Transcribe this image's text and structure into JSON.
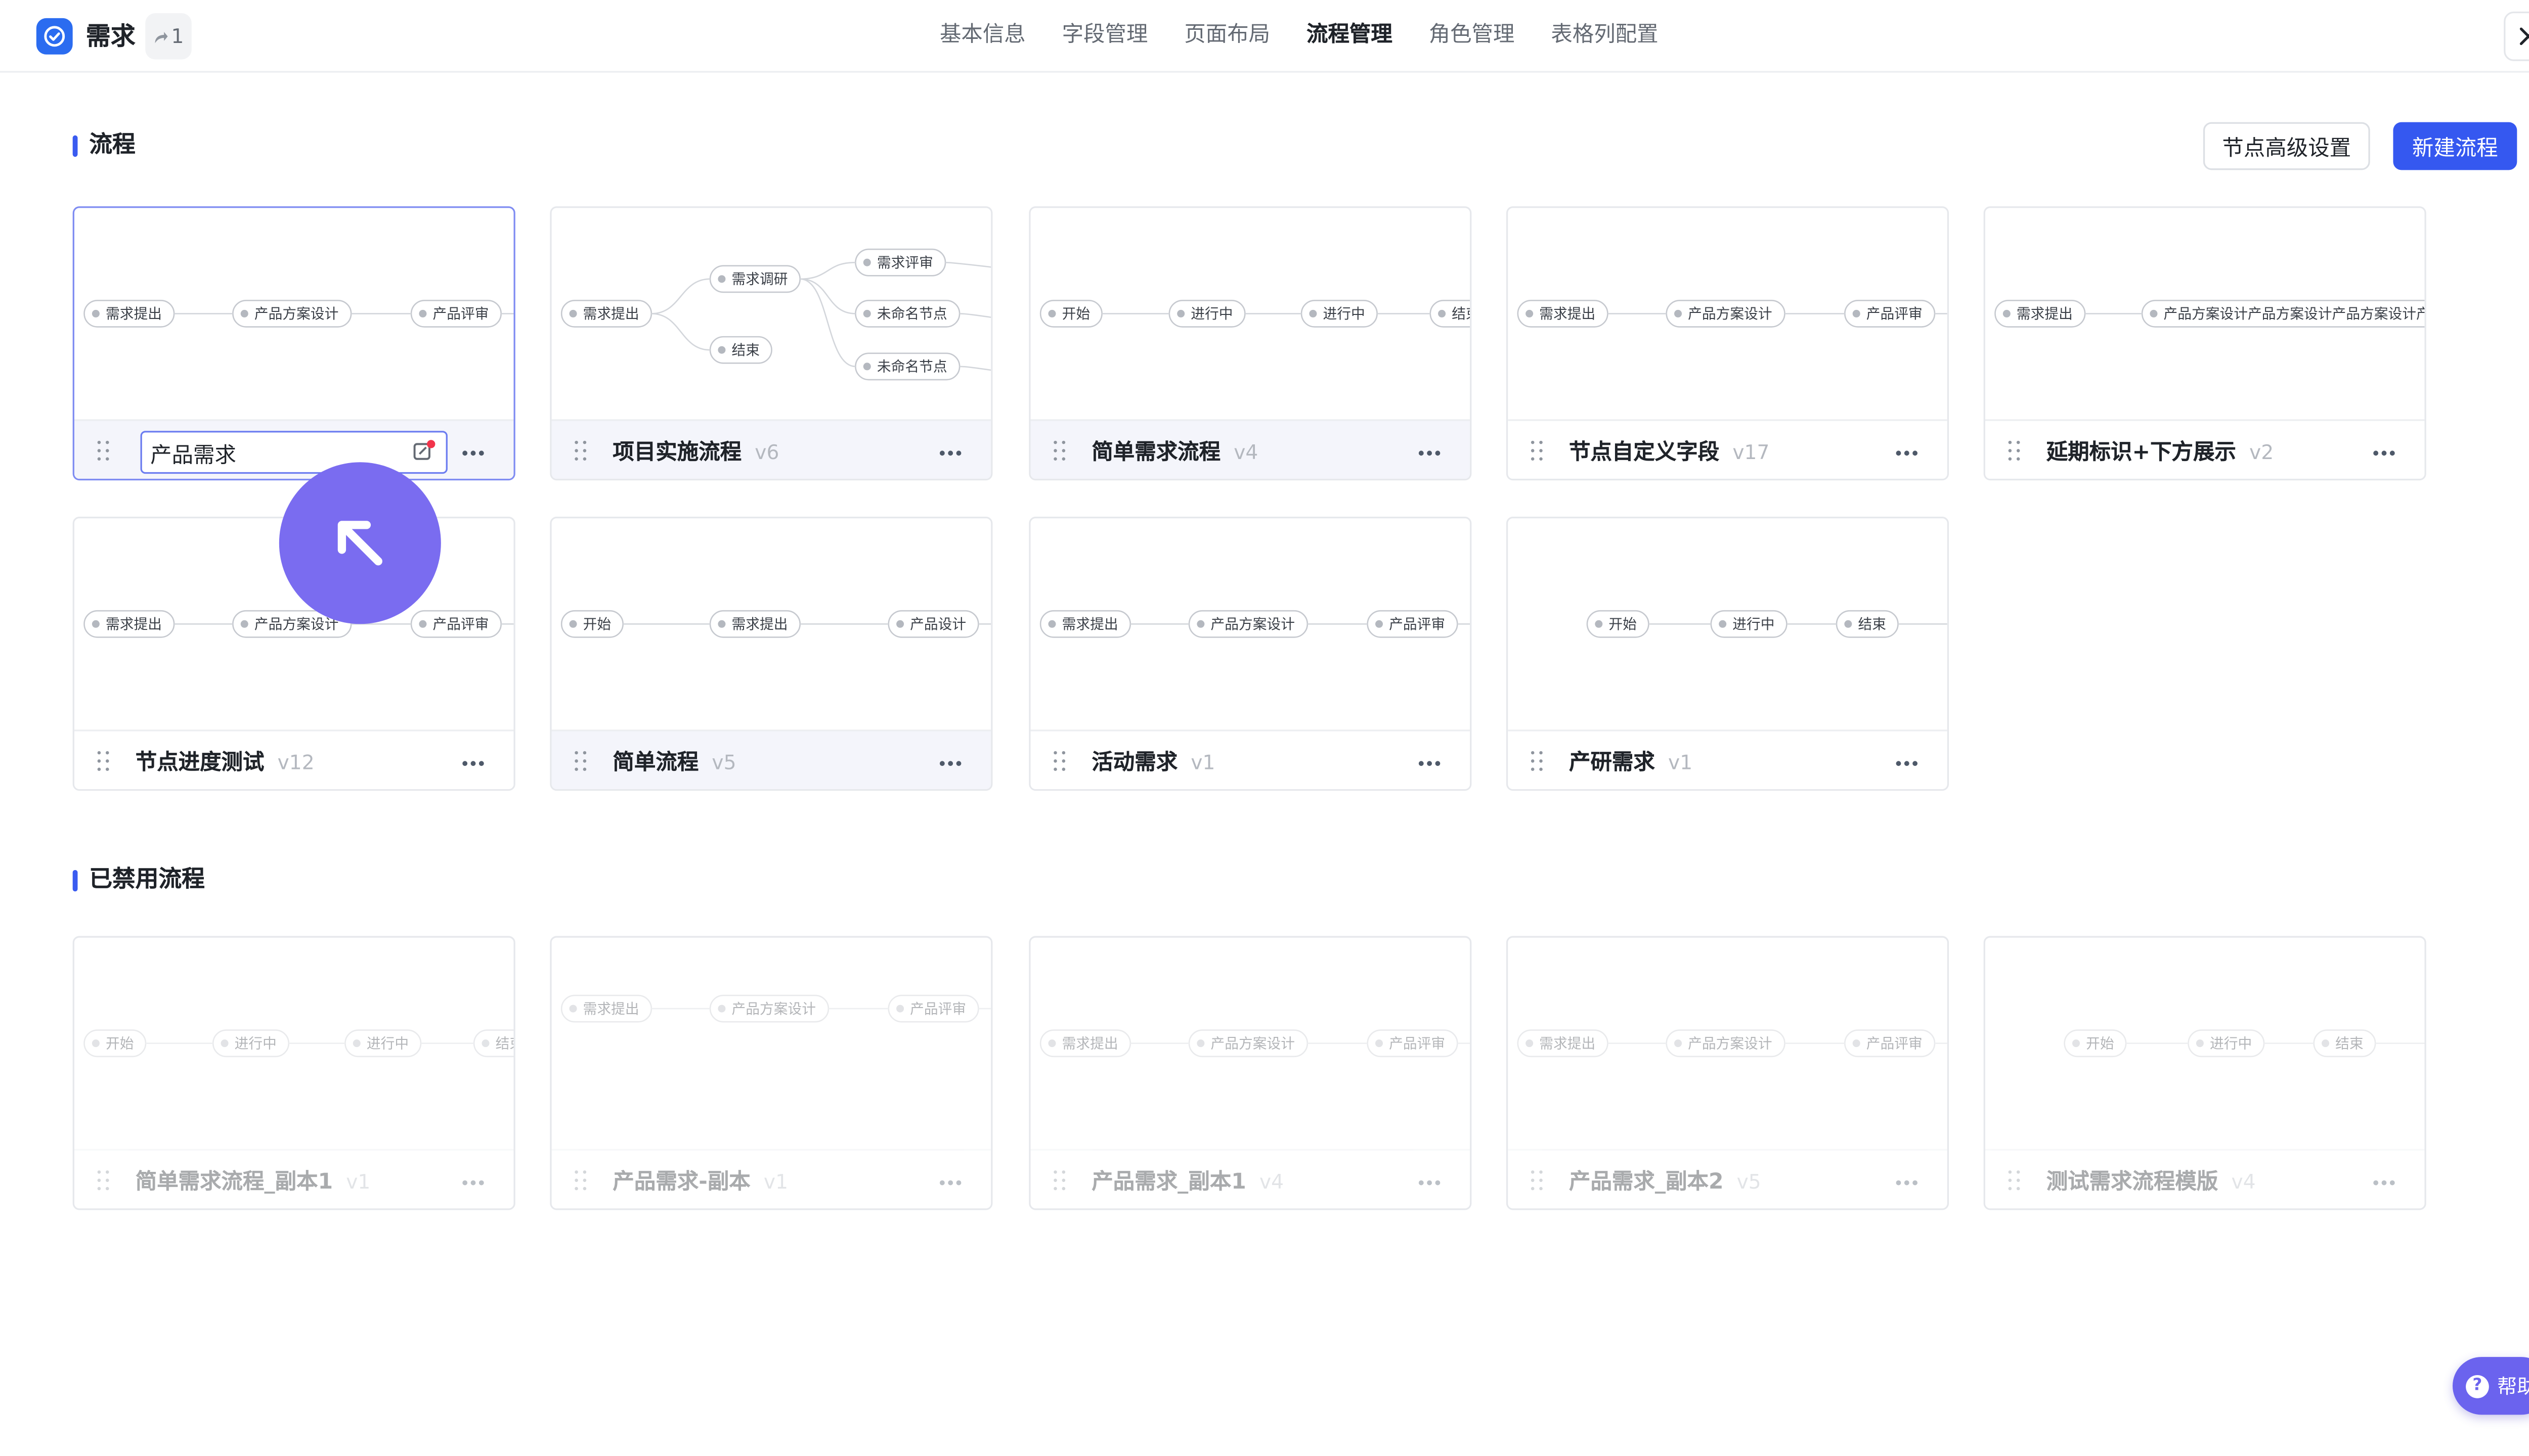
{
  "header": {
    "app_title": "需求",
    "share_count": "1",
    "tabs": [
      {
        "label": "基本信息",
        "active": false
      },
      {
        "label": "字段管理",
        "active": false
      },
      {
        "label": "页面布局",
        "active": false
      },
      {
        "label": "流程管理",
        "active": true
      },
      {
        "label": "角色管理",
        "active": false
      },
      {
        "label": "表格列配置",
        "active": false
      }
    ]
  },
  "section_flows": {
    "title": "流程",
    "advanced_settings_label": "节点高级设置",
    "new_flow_label": "新建流程"
  },
  "section_disabled": {
    "title": "已禁用流程"
  },
  "editing_value": "产品需求",
  "flows": [
    {
      "name": "产品需求",
      "version": "",
      "nodes": [
        "需求提出",
        "产品方案设计",
        "产品评审"
      ]
    },
    {
      "name": "项目实施流程",
      "version": "v6",
      "nodes": [
        "需求提出",
        "需求调研",
        "结束",
        "需求评审",
        "未命名节点",
        "未命名节点"
      ]
    },
    {
      "name": "简单需求流程",
      "version": "v4",
      "nodes": [
        "开始",
        "进行中",
        "进行中",
        "结束"
      ]
    },
    {
      "name": "节点自定义字段",
      "version": "v17",
      "nodes": [
        "需求提出",
        "产品方案设计",
        "产品评审"
      ]
    },
    {
      "name": "延期标识+下方展示",
      "version": "v2",
      "nodes": [
        "需求提出",
        "产品方案设计产品方案设计产品方案设计产"
      ]
    },
    {
      "name": "节点进度测试",
      "version": "v12",
      "nodes": [
        "需求提出",
        "产品方案设计",
        "产品评审"
      ]
    },
    {
      "name": "简单流程",
      "version": "v5",
      "nodes": [
        "开始",
        "需求提出",
        "产品设计"
      ]
    },
    {
      "name": "活动需求",
      "version": "v1",
      "nodes": [
        "需求提出",
        "产品方案设计",
        "产品评审"
      ]
    },
    {
      "name": "产研需求",
      "version": "v1",
      "nodes": [
        "开始",
        "进行中",
        "结束"
      ]
    }
  ],
  "disabled_flows": [
    {
      "name": "简单需求流程_副本1",
      "version": "v1",
      "nodes": [
        "开始",
        "进行中",
        "进行中",
        "结束"
      ]
    },
    {
      "name": "产品需求-副本",
      "version": "v1",
      "nodes": [
        "需求提出",
        "产品方案设计",
        "产品评审"
      ]
    },
    {
      "name": "产品需求_副本1",
      "version": "v4",
      "nodes": [
        "需求提出",
        "产品方案设计",
        "产品评审"
      ]
    },
    {
      "name": "产品需求_副本2",
      "version": "v5",
      "nodes": [
        "需求提出",
        "产品方案设计",
        "产品评审"
      ]
    },
    {
      "name": "测试需求流程模版",
      "version": "v4",
      "nodes": [
        "开始",
        "进行中",
        "结束"
      ]
    }
  ],
  "help_label": "帮助",
  "icons": {
    "app": "check-circle-icon",
    "share": "share-arrow-icon",
    "close": "close-icon",
    "drag": "drag-handle-icon",
    "more": "more-horizontal-icon",
    "cursor": "arrow-up-left-icon",
    "help": "question-circle-icon"
  },
  "colors": {
    "accent": "#3558f0",
    "cursor": "#7a6cf0",
    "help": "#6b63ee"
  }
}
